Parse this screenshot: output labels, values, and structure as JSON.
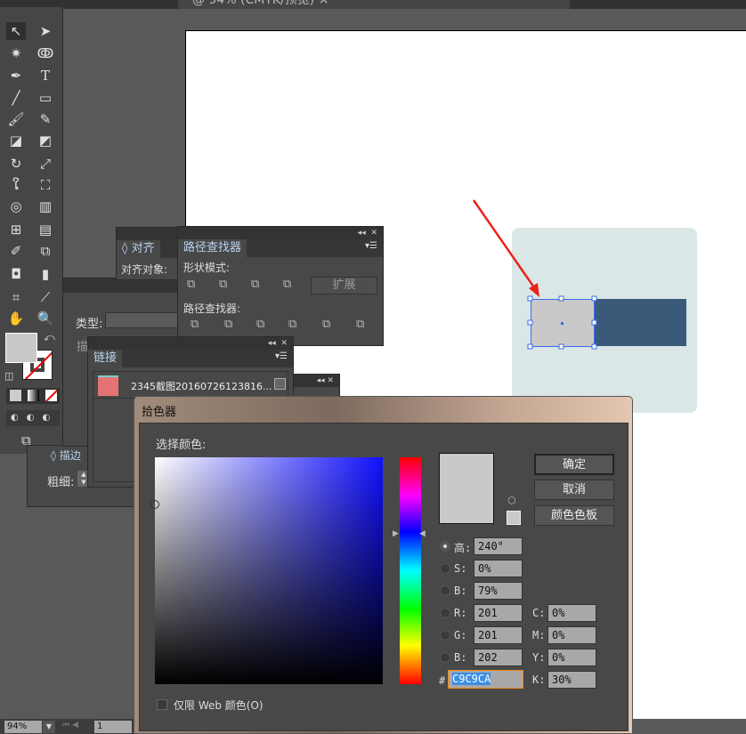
{
  "document": {
    "tab_title": "@ 94% (CMYK/预览)"
  },
  "align_panel": {
    "tab": "对齐",
    "align_to_label": "对齐对象:"
  },
  "pathfinder_panel": {
    "tab": "路径查找器",
    "shape_modes_label": "形状模式:",
    "expand_button": "扩展",
    "pathfinders_label": "路径查找器:"
  },
  "hidden_panel": {
    "type_label": "类型:",
    "stroke_label_partial": "描"
  },
  "stroke_panel": {
    "tab": "描边",
    "weight_label": "粗细:"
  },
  "links_panel": {
    "tab": "链接",
    "item": "2345截图20160726123816..."
  },
  "color_picker": {
    "title": "拾色器",
    "select_color_label": "选择颜色:",
    "ok_button": "确定",
    "cancel_button": "取消",
    "swatches_button": "颜色色板",
    "fields": {
      "H_label": "高:",
      "H": "240°",
      "S_label": "S:",
      "S": "0%",
      "B_label": "B:",
      "B": "79%",
      "R_label": "R:",
      "R": "201",
      "G_label": "G:",
      "G": "201",
      "Bl_label": "B:",
      "Bl": "202",
      "hex_label": "#",
      "hex": "C9C9CA",
      "C_label": "C:",
      "C": "0%",
      "M_label": "M:",
      "M": "0%",
      "Y_label": "Y:",
      "Y": "0%",
      "K_label": "K:",
      "K": "30%"
    },
    "web_only_label": "仅限 Web 颜色(O)",
    "selected_hue_mode": "H",
    "current_color": "#c9c9ca"
  },
  "status_bar": {
    "zoom": "94%",
    "page": "1"
  },
  "colors": {
    "fill": "#c9c9ca",
    "dark_rect": "#3b5a7a",
    "bg_rect": "#dbe7e6",
    "arrow": "#e8231f"
  }
}
